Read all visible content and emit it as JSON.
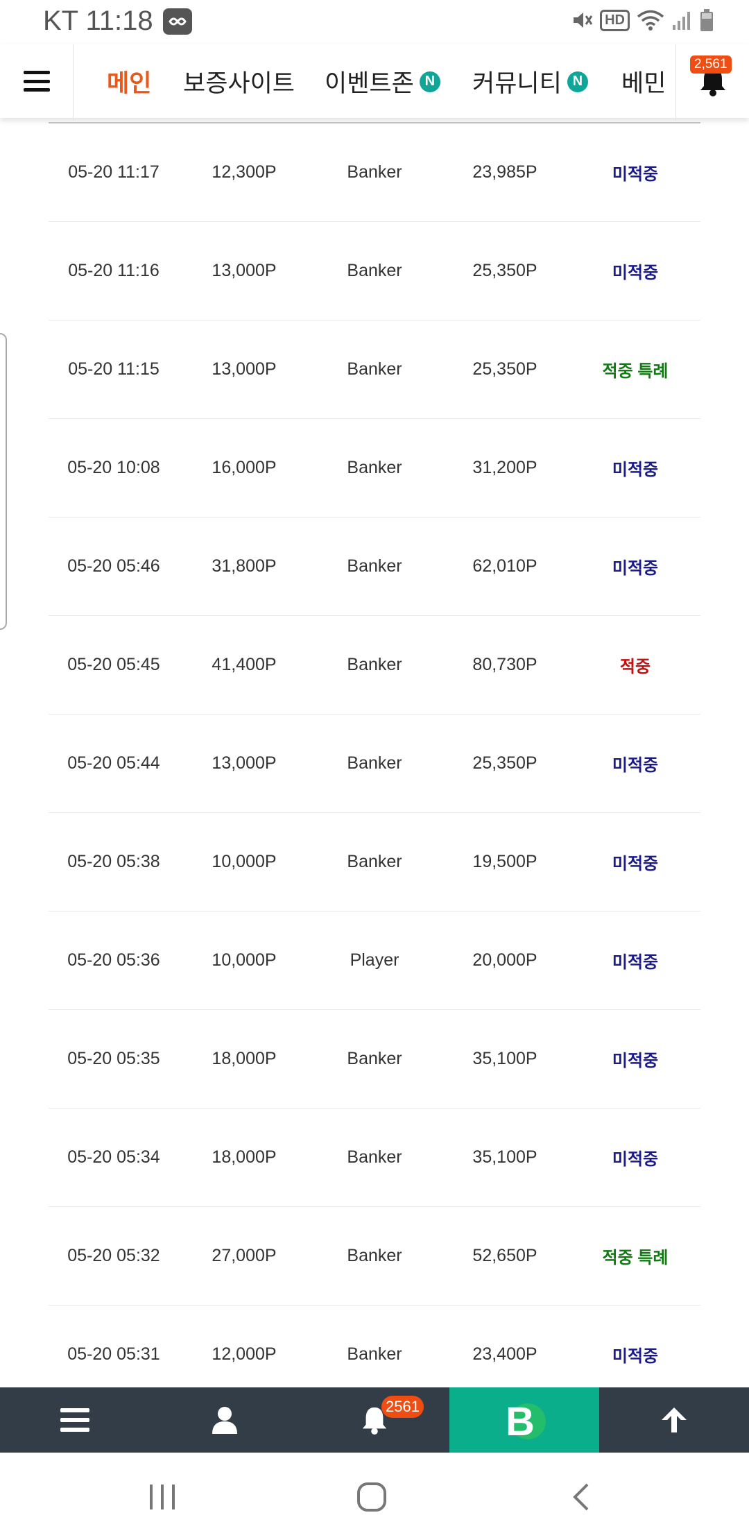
{
  "status_bar": {
    "carrier_time": "KT 11:18",
    "hd_label": "HD"
  },
  "nav": {
    "tabs": [
      {
        "label": "메인",
        "active": true,
        "new": false
      },
      {
        "label": "보증사이트",
        "active": false,
        "new": false
      },
      {
        "label": "이벤트존",
        "active": false,
        "new": true
      },
      {
        "label": "커뮤니티",
        "active": false,
        "new": true
      },
      {
        "label": "베민",
        "active": false,
        "new": false
      }
    ],
    "new_badge": "N",
    "notification_count": "2,561"
  },
  "rows": [
    {
      "date": "05-20 11:17",
      "bet": "12,300P",
      "pick": "Banker",
      "payout": "23,985P",
      "result": "미적중",
      "result_type": "miss"
    },
    {
      "date": "05-20 11:16",
      "bet": "13,000P",
      "pick": "Banker",
      "payout": "25,350P",
      "result": "미적중",
      "result_type": "miss"
    },
    {
      "date": "05-20 11:15",
      "bet": "13,000P",
      "pick": "Banker",
      "payout": "25,350P",
      "result": "적중 특례",
      "result_type": "special"
    },
    {
      "date": "05-20 10:08",
      "bet": "16,000P",
      "pick": "Banker",
      "payout": "31,200P",
      "result": "미적중",
      "result_type": "miss"
    },
    {
      "date": "05-20 05:46",
      "bet": "31,800P",
      "pick": "Banker",
      "payout": "62,010P",
      "result": "미적중",
      "result_type": "miss"
    },
    {
      "date": "05-20 05:45",
      "bet": "41,400P",
      "pick": "Banker",
      "payout": "80,730P",
      "result": "적중",
      "result_type": "hit"
    },
    {
      "date": "05-20 05:44",
      "bet": "13,000P",
      "pick": "Banker",
      "payout": "25,350P",
      "result": "미적중",
      "result_type": "miss"
    },
    {
      "date": "05-20 05:38",
      "bet": "10,000P",
      "pick": "Banker",
      "payout": "19,500P",
      "result": "미적중",
      "result_type": "miss"
    },
    {
      "date": "05-20 05:36",
      "bet": "10,000P",
      "pick": "Player",
      "payout": "20,000P",
      "result": "미적중",
      "result_type": "miss"
    },
    {
      "date": "05-20 05:35",
      "bet": "18,000P",
      "pick": "Banker",
      "payout": "35,100P",
      "result": "미적중",
      "result_type": "miss"
    },
    {
      "date": "05-20 05:34",
      "bet": "18,000P",
      "pick": "Banker",
      "payout": "35,100P",
      "result": "미적중",
      "result_type": "miss"
    },
    {
      "date": "05-20 05:32",
      "bet": "27,000P",
      "pick": "Banker",
      "payout": "52,650P",
      "result": "적중 특례",
      "result_type": "special"
    },
    {
      "date": "05-20 05:31",
      "bet": "12,000P",
      "pick": "Banker",
      "payout": "23,400P",
      "result": "미적중",
      "result_type": "miss"
    }
  ],
  "bottom_bar": {
    "items": [
      "menu-icon",
      "user-icon",
      "bell-icon",
      "brand-logo-icon",
      "arrow-up-icon"
    ],
    "notification_count": "2561",
    "logo_letter": "B"
  },
  "colors": {
    "accent": "#e8591c",
    "new_badge": "#0fa598",
    "miss": "#1a1a8e",
    "special": "#127a12",
    "hit": "#c21010",
    "bottom_bar": "#333d47",
    "bottom_green": "#0aae8a"
  }
}
